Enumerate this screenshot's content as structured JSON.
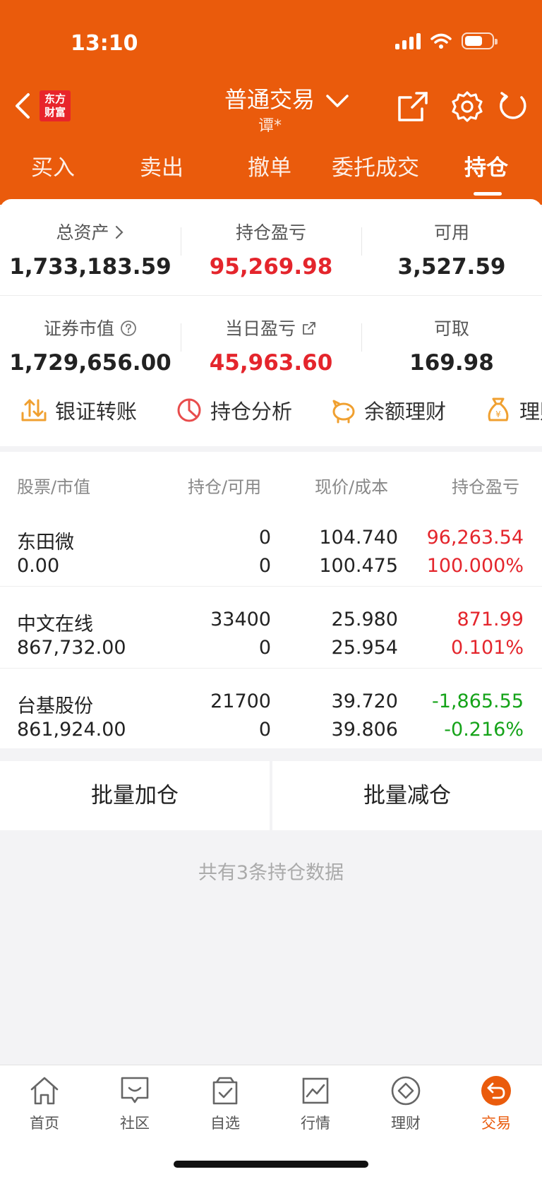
{
  "status_bar": {
    "time": "13:10"
  },
  "header": {
    "logo_text": "东方财富",
    "title": "普通交易",
    "subtitle": "谭*"
  },
  "tabs": [
    {
      "label": "买入"
    },
    {
      "label": "卖出"
    },
    {
      "label": "撤单"
    },
    {
      "label": "委托成交"
    },
    {
      "label": "持仓",
      "active": true
    }
  ],
  "summary": {
    "total_assets_label": "总资产",
    "total_assets": "1,733,183.59",
    "position_pnl_label": "持仓盈亏",
    "position_pnl": "95,269.98",
    "available_label": "可用",
    "available": "3,527.59",
    "market_value_label": "证券市值",
    "market_value": "1,729,656.00",
    "daily_pnl_label": "当日盈亏",
    "daily_pnl": "45,963.60",
    "withdrawable_label": "可取",
    "withdrawable": "169.98"
  },
  "quick_actions": [
    {
      "label": "银证转账",
      "icon": "transfer-icon"
    },
    {
      "label": "持仓分析",
      "icon": "pie-chart-icon"
    },
    {
      "label": "余额理财",
      "icon": "piggy-bank-icon"
    },
    {
      "label": "理财",
      "icon": "money-bag-icon"
    }
  ],
  "table": {
    "headers": [
      "股票/市值",
      "持仓/可用",
      "现价/成本",
      "持仓盈亏"
    ],
    "rows": [
      {
        "name": "东田微",
        "market_value": "0.00",
        "position": "0",
        "available": "0",
        "price": "104.740",
        "cost": "100.475",
        "pnl": "96,263.54",
        "pnl_pct": "100.000%",
        "trend": "up"
      },
      {
        "name": "中文在线",
        "market_value": "867,732.00",
        "position": "33400",
        "available": "0",
        "price": "25.980",
        "cost": "25.954",
        "pnl": "871.99",
        "pnl_pct": "0.101%",
        "trend": "up"
      },
      {
        "name": "台基股份",
        "market_value": "861,924.00",
        "position": "21700",
        "available": "0",
        "price": "39.720",
        "cost": "39.806",
        "pnl": "-1,865.55",
        "pnl_pct": "-0.216%",
        "trend": "down"
      }
    ]
  },
  "batch": {
    "add_label": "批量加仓",
    "reduce_label": "批量减仓"
  },
  "footer_text": "共有3条持仓数据",
  "bottom_nav": [
    {
      "label": "首页",
      "icon": "home-icon"
    },
    {
      "label": "社区",
      "icon": "community-icon"
    },
    {
      "label": "自选",
      "icon": "watchlist-icon"
    },
    {
      "label": "行情",
      "icon": "market-chart-icon"
    },
    {
      "label": "理财",
      "icon": "wealth-icon"
    },
    {
      "label": "交易",
      "icon": "trade-icon",
      "active": true
    }
  ],
  "colors": {
    "brand": "#ea5b0c",
    "up": "#e4252c",
    "down": "#15a319"
  }
}
